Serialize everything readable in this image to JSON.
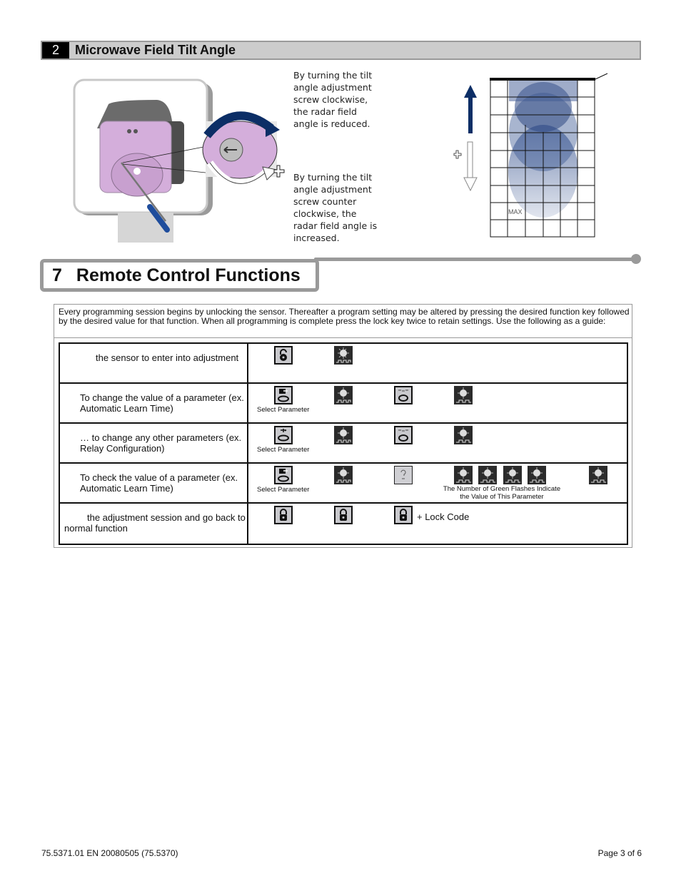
{
  "section2": {
    "number": "2",
    "title": "Microwave Field Tilt Angle",
    "desc_clockwise": "By turning the tilt angle adjustment screw clockwise, the radar field angle is reduced.",
    "desc_counter": "By turning the tilt angle adjustment screw counter clockwise, the radar field angle is increased.",
    "diagram_label": "MAX",
    "plus_symbol": "+",
    "colors": {
      "arrow_blue": "#0c2e66",
      "device_pink": "#d9b5d9",
      "field_blue": "#3f5a94"
    }
  },
  "section7": {
    "number": "7",
    "title": "Remote Control Functions",
    "intro": "Every programming session begins by unlocking the sensor. Thereafter a program setting may be altered by pressing the desired function key followed by the desired value for that function. When all programming is complete press the lock key twice to retain settings. Use the following as a guide:",
    "steps": [
      {
        "label": "the sensor to enter into adjustment",
        "icons": [
          "unlock-key",
          "led-flash"
        ]
      },
      {
        "label": "To change the value of a parameter (ex. Automatic Learn Time)",
        "caption": "Select Parameter",
        "icons": [
          "parameter-key",
          "led-flash",
          "value-key",
          "led-flash"
        ]
      },
      {
        "label": "… to change any other parameters (ex. Relay Configuration)",
        "caption": "Select Parameter",
        "icons": [
          "relay-parameter-key",
          "led-flash",
          "value-key",
          "led-flash"
        ]
      },
      {
        "label": "To check the value of a parameter (ex. Automatic Learn Time)",
        "caption": "Select Parameter",
        "flash_caption_1": "The Number of Green Flashes Indicate",
        "flash_caption_2": "the Value of This Parameter",
        "icons": [
          "parameter-key",
          "led-flash",
          "query-key",
          "led-flash",
          "led-flash",
          "led-flash",
          "led-flash",
          "led-flash"
        ]
      },
      {
        "label": "the adjustment session and go back to normal function",
        "suffix": "+ Lock Code",
        "icons": [
          "lock-key",
          "lock-key",
          "lock-key"
        ]
      }
    ]
  },
  "footer": {
    "doc_ref": "75.5371.01  EN   20080505   (75.5370)",
    "page": "Page 3 of 6"
  }
}
